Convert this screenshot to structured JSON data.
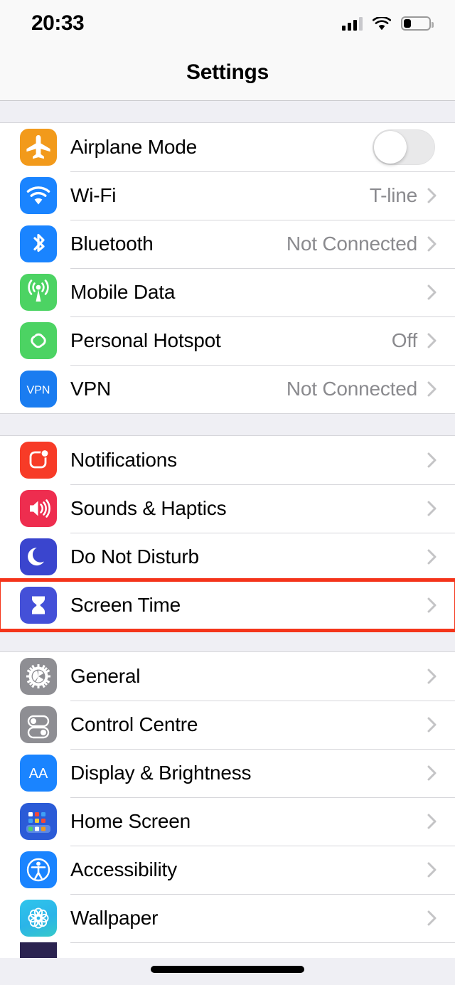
{
  "status_bar": {
    "time": "20:33",
    "cellular_icon": "cellular-bars-icon",
    "cellular_bars_filled": 3,
    "cellular_bars_total": 4,
    "wifi_icon": "wifi-icon",
    "battery_icon": "battery-icon",
    "battery_level_percent": 26
  },
  "navbar": {
    "title": "Settings"
  },
  "highlight": {
    "target": "Screen Time",
    "color": "#F4341A"
  },
  "home_indicator": "home-indicator",
  "groups": [
    {
      "id": "connectivity",
      "rows": [
        {
          "name": "airplane-mode",
          "label": "Airplane Mode",
          "icon": "airplane-icon",
          "value": "",
          "accessory": "toggle",
          "toggle_on": false
        },
        {
          "name": "wifi",
          "label": "Wi-Fi",
          "icon": "wifi-icon",
          "value": "T-line",
          "accessory": "chevron"
        },
        {
          "name": "bluetooth",
          "label": "Bluetooth",
          "icon": "bluetooth-icon",
          "value": "Not Connected",
          "accessory": "chevron"
        },
        {
          "name": "mobile-data",
          "label": "Mobile Data",
          "icon": "antenna-icon",
          "value": "",
          "accessory": "chevron"
        },
        {
          "name": "personal-hotspot",
          "label": "Personal Hotspot",
          "icon": "hotspot-link-icon",
          "value": "Off",
          "accessory": "chevron"
        },
        {
          "name": "vpn",
          "label": "VPN",
          "icon": "vpn-icon",
          "value": "Not Connected",
          "accessory": "chevron"
        }
      ]
    },
    {
      "id": "alerts",
      "rows": [
        {
          "name": "notifications",
          "label": "Notifications",
          "icon": "notifications-icon",
          "value": "",
          "accessory": "chevron"
        },
        {
          "name": "sounds-haptics",
          "label": "Sounds & Haptics",
          "icon": "speaker-icon",
          "value": "",
          "accessory": "chevron"
        },
        {
          "name": "do-not-disturb",
          "label": "Do Not Disturb",
          "icon": "moon-icon",
          "value": "",
          "accessory": "chevron"
        },
        {
          "name": "screen-time",
          "label": "Screen Time",
          "icon": "hourglass-icon",
          "value": "",
          "accessory": "chevron",
          "highlighted": true
        }
      ]
    },
    {
      "id": "system",
      "rows": [
        {
          "name": "general",
          "label": "General",
          "icon": "gear-icon",
          "value": "",
          "accessory": "chevron"
        },
        {
          "name": "control-centre",
          "label": "Control Centre",
          "icon": "sliders-icon",
          "value": "",
          "accessory": "chevron"
        },
        {
          "name": "display-brightness",
          "label": "Display & Brightness",
          "icon": "aa-text-icon",
          "value": "",
          "accessory": "chevron"
        },
        {
          "name": "home-screen",
          "label": "Home Screen",
          "icon": "app-grid-icon",
          "value": "",
          "accessory": "chevron"
        },
        {
          "name": "accessibility",
          "label": "Accessibility",
          "icon": "accessibility-icon",
          "value": "",
          "accessory": "chevron"
        },
        {
          "name": "wallpaper",
          "label": "Wallpaper",
          "icon": "flower-icon",
          "value": "",
          "accessory": "chevron"
        }
      ]
    }
  ]
}
